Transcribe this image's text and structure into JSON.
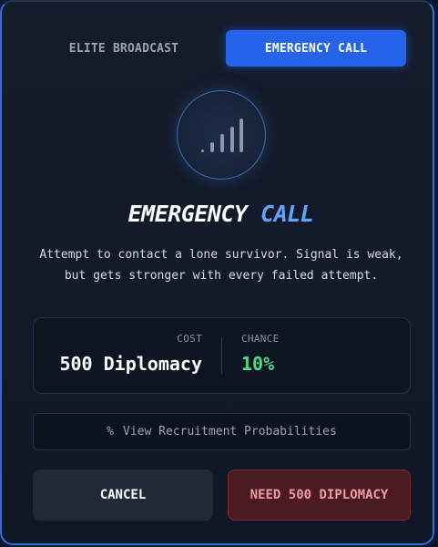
{
  "tabs": {
    "elite_label": "ELITE BROADCAST",
    "emergency_label": "EMERGENCY CALL",
    "active": "EMERGENCY CALL"
  },
  "header": {
    "icon": "signal-bars-icon",
    "title_part1": "EMERGENCY",
    "title_part2": "CALL"
  },
  "description": {
    "line1": "Attempt to contact a lone survivor. Signal is weak,",
    "line2": "but gets stronger with every failed attempt."
  },
  "stats": {
    "cost_label": "COST",
    "cost_value": "500 Diplomacy",
    "chance_label": "CHANCE",
    "chance_value": "10%"
  },
  "probabilities_button": {
    "icon": "percent-icon",
    "label": "View Recruitment Probabilities"
  },
  "actions": {
    "cancel_label": "CANCEL",
    "confirm_label": "NEED 500 DIPLOMACY"
  },
  "colors": {
    "accent_blue": "#2563eb",
    "title_blue": "#60a5fa",
    "chance_green": "#4ade80",
    "danger_red": "#f19aa0"
  }
}
